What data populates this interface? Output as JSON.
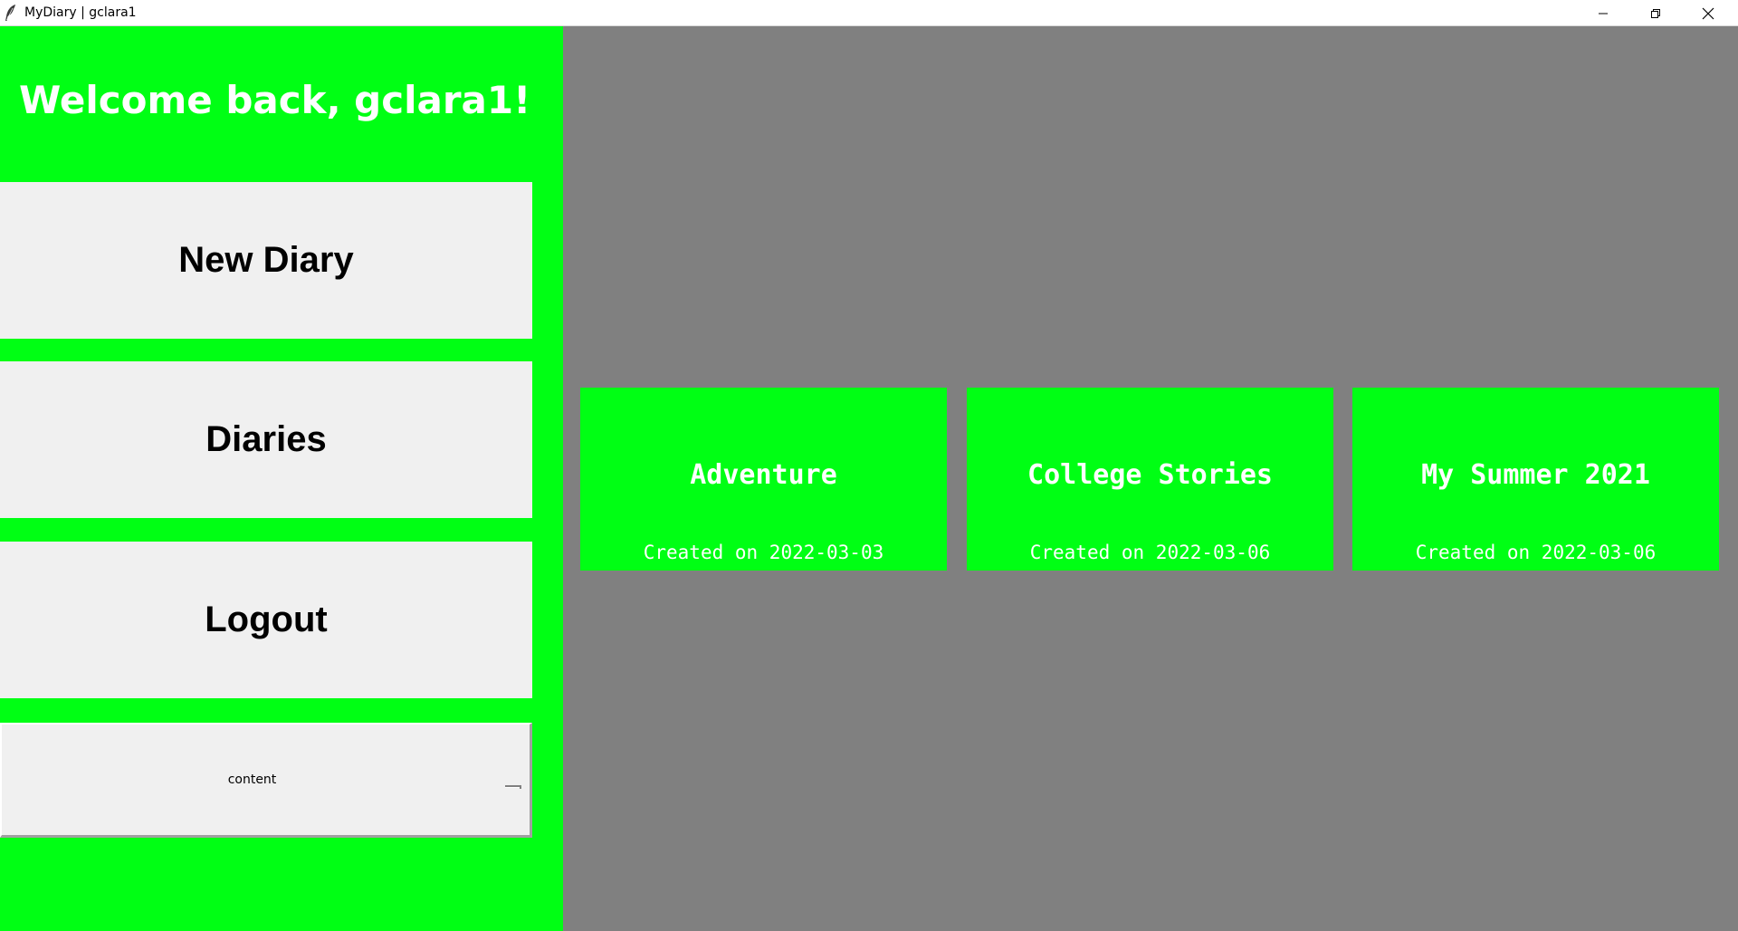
{
  "window": {
    "title": "MyDiary | gclara1",
    "icon": "feather-icon",
    "controls": {
      "minimize": "minimize-icon",
      "maximize": "restore-icon",
      "close": "close-icon"
    }
  },
  "sidebar": {
    "welcome": "Welcome back, gclara1!",
    "buttons": {
      "new_diary": "New Diary",
      "diaries": "Diaries",
      "logout": "Logout"
    },
    "select": {
      "value": "content",
      "indicator": "option-menu-indicator-icon"
    }
  },
  "diaries": [
    {
      "title": "Adventure",
      "created": "Created on 2022-03-03"
    },
    {
      "title": "College Stories",
      "created": "Created on 2022-03-06"
    },
    {
      "title": "My Summer 2021",
      "created": "Created on 2022-03-06"
    }
  ],
  "colors": {
    "accent_green": "#00ff14",
    "main_background": "#808080",
    "button_background": "#f0f0f0",
    "text_on_green": "#ffffff"
  }
}
